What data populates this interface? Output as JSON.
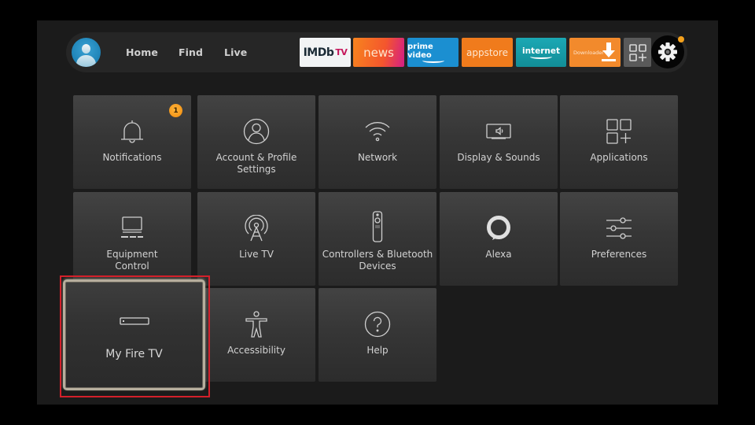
{
  "nav": {
    "profile_icon": "user-avatar-icon",
    "links": [
      {
        "label": "Home"
      },
      {
        "label": "Find"
      },
      {
        "label": "Live"
      }
    ],
    "apps": [
      {
        "name": "IMDb TV",
        "label": "IMDb",
        "label_suffix": "TV",
        "color": "#f2f4f5"
      },
      {
        "name": "News",
        "label": "news",
        "color": "#f4562d"
      },
      {
        "name": "Prime Video",
        "label": "prime video",
        "color": "#1b8fd1"
      },
      {
        "name": "Appstore",
        "label": "appstore",
        "color": "#f07b1c"
      },
      {
        "name": "Internet",
        "label": "internet",
        "color": "#1ba8b4"
      },
      {
        "name": "Downloader",
        "label": "Downloader",
        "color": "#f28a2c"
      }
    ],
    "all_apps_icon": "apps-grid-plus-icon",
    "settings_icon": "gear-icon",
    "settings_notification_dot_color": "#f4a11c"
  },
  "settings": {
    "tiles": [
      {
        "label": "Notifications",
        "icon": "bell-icon",
        "badge": "1"
      },
      {
        "label": "Account & Profile Settings",
        "icon": "user-circle-icon"
      },
      {
        "label": "Network",
        "icon": "wifi-icon"
      },
      {
        "label": "Display & Sounds",
        "icon": "tv-speaker-icon"
      },
      {
        "label": "Applications",
        "icon": "apps-grid-plus-icon"
      },
      {
        "label": "Equipment Control",
        "icon": "tv-soundbar-icon"
      },
      {
        "label": "Live TV",
        "icon": "antenna-icon"
      },
      {
        "label": "Controllers & Bluetooth Devices",
        "icon": "remote-icon"
      },
      {
        "label": "Alexa",
        "icon": "alexa-ring-icon"
      },
      {
        "label": "Preferences",
        "icon": "sliders-icon"
      },
      {
        "label": "My Fire TV",
        "icon": "fire-tv-stick-icon",
        "focused": true
      },
      {
        "label": "Accessibility",
        "icon": "accessibility-icon"
      },
      {
        "label": "Help",
        "icon": "help-circle-icon"
      }
    ]
  },
  "annotation": {
    "highlight_color": "#d3202a",
    "highlighted_item": "My Fire TV"
  }
}
